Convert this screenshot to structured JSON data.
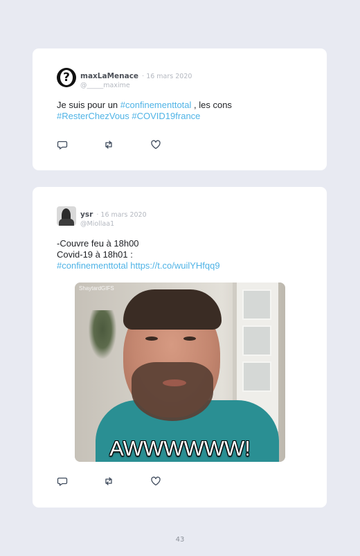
{
  "tweets": [
    {
      "name": "maxLaMenace",
      "date": "· 16 mars 2020",
      "handle": "@_____maxime",
      "text_plain_1": "Je suis pour un ",
      "hashtag_1": "#confinementtotal",
      "text_plain_2": " , les cons",
      "hashtag_2": "#ResterChezVous",
      "hashtag_3": "#COVID19france"
    },
    {
      "name": "ysr",
      "date": "· 16 mars 2020",
      "handle": "@Miollaa1",
      "line_1": "-Couvre feu à 18h00",
      "line_2": "Covid-19 à 18h01 :",
      "hashtag_1": "#confinementtotal",
      "link": "https://t.co/wuilYHfqq9",
      "gif_watermark": "ShaytardGIFS",
      "gif_caption": "AWWWWWW!"
    }
  ],
  "icons": [
    "reply-icon",
    "retweet-icon",
    "like-icon"
  ],
  "colors": {
    "hashtag": "#4fb3e6",
    "background": "#e8eaf2",
    "card": "#ffffff"
  },
  "page_number": "43"
}
